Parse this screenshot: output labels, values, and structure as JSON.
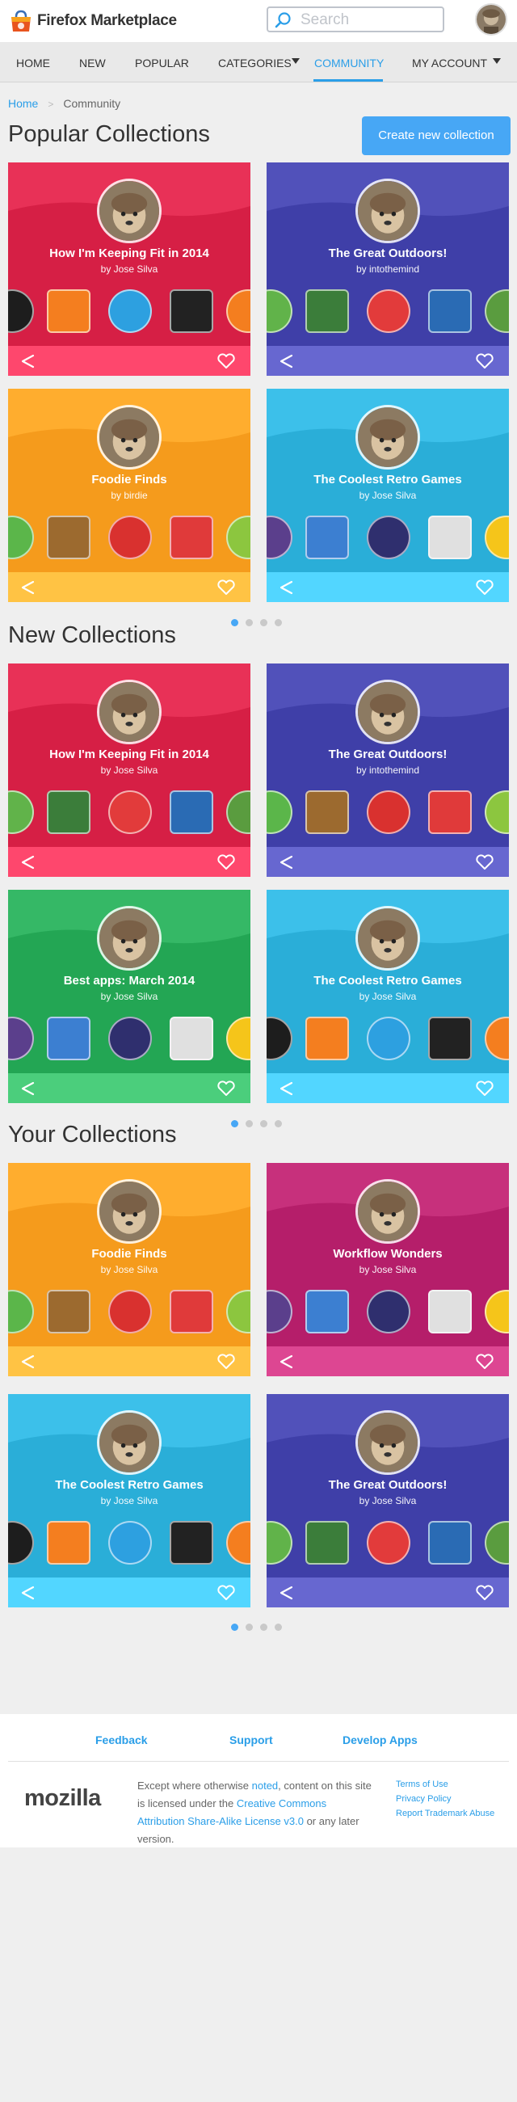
{
  "header": {
    "brand": "Firefox Marketplace",
    "search_placeholder": "Search"
  },
  "nav": {
    "items": [
      "Home",
      "New",
      "Popular",
      "Categories",
      "Community",
      "My Account"
    ],
    "active": "Community"
  },
  "breadcrumb": {
    "home": "Home",
    "current": "Community"
  },
  "create_button": "Create new collection",
  "sections": [
    {
      "title": "Popular Collections",
      "cards": [
        {
          "title": "How I'm Keeping Fit in 2014",
          "author": "by Jose Silva",
          "color": "#d61f45"
        },
        {
          "title": "The Great Outdoors!",
          "author": "by intothemind",
          "color": "#3f3fa8"
        },
        {
          "title": "Foodie Finds",
          "author": "by birdie",
          "color": "#f59b1c"
        },
        {
          "title": "The Coolest Retro Games",
          "author": "by Jose Silva",
          "color": "#2aaed8"
        }
      ]
    },
    {
      "title": "New Collections",
      "cards": [
        {
          "title": "How I'm Keeping Fit in 2014",
          "author": "by Jose Silva",
          "color": "#d61f45"
        },
        {
          "title": "The Great Outdoors!",
          "author": "by intothemind",
          "color": "#3f3fa8"
        },
        {
          "title": "Best apps: March 2014",
          "author": "by Jose Silva",
          "color": "#23a654"
        },
        {
          "title": "The Coolest Retro Games",
          "author": "by Jose Silva",
          "color": "#2aaed8"
        }
      ]
    },
    {
      "title": "Your Collections",
      "cards": [
        {
          "title": "Foodie Finds",
          "author": "by Jose Silva",
          "color": "#f59b1c"
        },
        {
          "title": "Workflow Wonders",
          "author": "by Jose Silva",
          "color": "#b51e6a"
        },
        {
          "title": "The Coolest Retro Games",
          "author": "by Jose Silva",
          "color": "#2aaed8"
        },
        {
          "title": "The Great Outdoors!",
          "author": "by Jose Silva",
          "color": "#3f3fa8"
        }
      ]
    }
  ],
  "footer": {
    "links": [
      "Feedback",
      "Support",
      "Develop Apps"
    ],
    "mozilla": "mozilla",
    "license_pre": "Except where otherwise ",
    "license_noted": "noted",
    "license_mid": ", content on this site is licensed under the ",
    "license_link": "Creative Commons Attribution Share-Alike License v3.0",
    "license_post": " or any later version.",
    "legal": [
      "Terms of Use",
      "Privacy Policy",
      "Report Trademark Abuse"
    ]
  }
}
